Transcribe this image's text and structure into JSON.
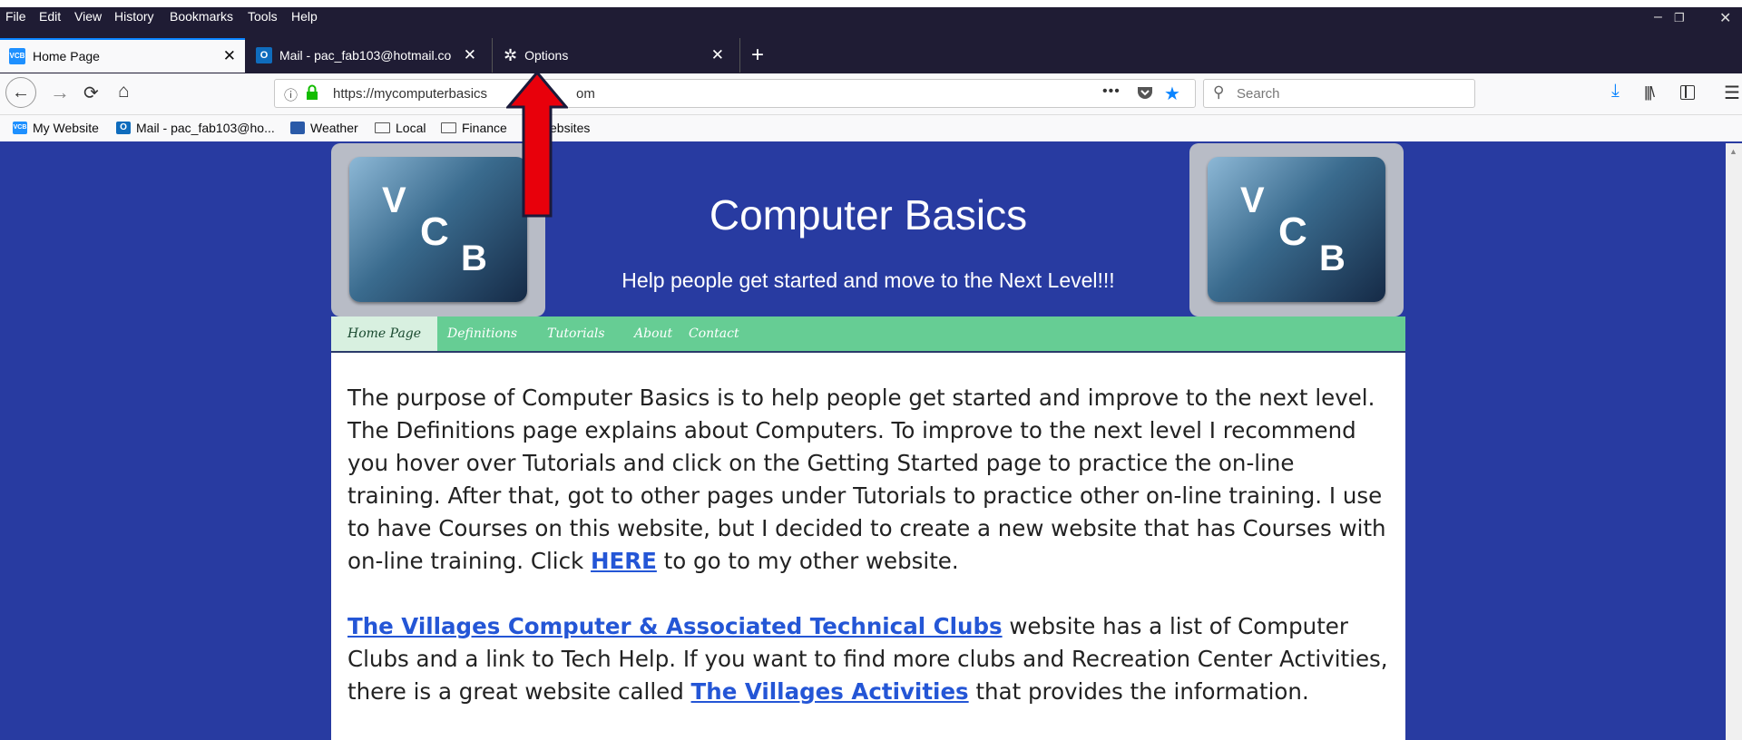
{
  "menu": [
    "File",
    "Edit",
    "View",
    "History",
    "Bookmarks",
    "Tools",
    "Help"
  ],
  "window_controls": {
    "minimize": "–",
    "restore": "❐",
    "close": "✕"
  },
  "tabs": [
    {
      "label": "Home Page",
      "favicon": "VCB",
      "favicon_color": "#1e90ff"
    },
    {
      "label": "Mail - pac_fab103@hotmail.co",
      "favicon": "O",
      "favicon_color": "#0f6cbd"
    },
    {
      "label": "Options",
      "favicon": "gear"
    }
  ],
  "new_tab": "+",
  "url": "https://mycomputerbasics.com",
  "url_visible": {
    "start": "https://mycomputerbasics",
    "end": "om"
  },
  "search_placeholder": "Search",
  "page_actions": "•••",
  "bookmarks": [
    {
      "label": "My Website",
      "icon": "VCB"
    },
    {
      "label": "Mail - pac_fab103@ho...",
      "icon": "O"
    },
    {
      "label": "Weather",
      "icon": "weather"
    },
    {
      "label": "Local",
      "icon": "folder"
    },
    {
      "label": "Finance",
      "icon": "folder"
    },
    {
      "label": "ebsites",
      "icon": "folder"
    }
  ],
  "site": {
    "logo_letters": {
      "v": "V",
      "c": "C",
      "b": "B"
    },
    "title": "Computer Basics",
    "subtitle": "Help people get started and move to the Next Level!!!",
    "nav": [
      "Home Page",
      "Definitions",
      "Tutorials",
      "About",
      "Contact"
    ],
    "para1": {
      "text": "The purpose of Computer Basics is to help people get started and improve to the next level. The Definitions page explains about Computers.  To improve to the next level I recommend you hover over Tutorials and click on the Getting Started page to practice the on-line training.  After that, got to other pages under Tutorials to practice other on-line training.  I use to have Courses on this website, but I decided to create a new website that has Courses with on-line training.  Click ",
      "link": "HERE",
      "after": " to go to my other website."
    },
    "para2": {
      "link1": "The Villages Computer & Associated Technical Clubs",
      "text1": " website has a list of Computer Clubs and a link to Tech Help.  If you want to find more clubs and Recreation Center Activities, there is a great website called ",
      "link2": "The Villages Activities",
      "text2": " that provides the information."
    }
  },
  "colors": {
    "browser_chrome": "#1f1c34",
    "page_bg": "#283ba1",
    "nav_green": "#66cd94",
    "arrow": "#e8000b",
    "link": "#2456d6"
  }
}
